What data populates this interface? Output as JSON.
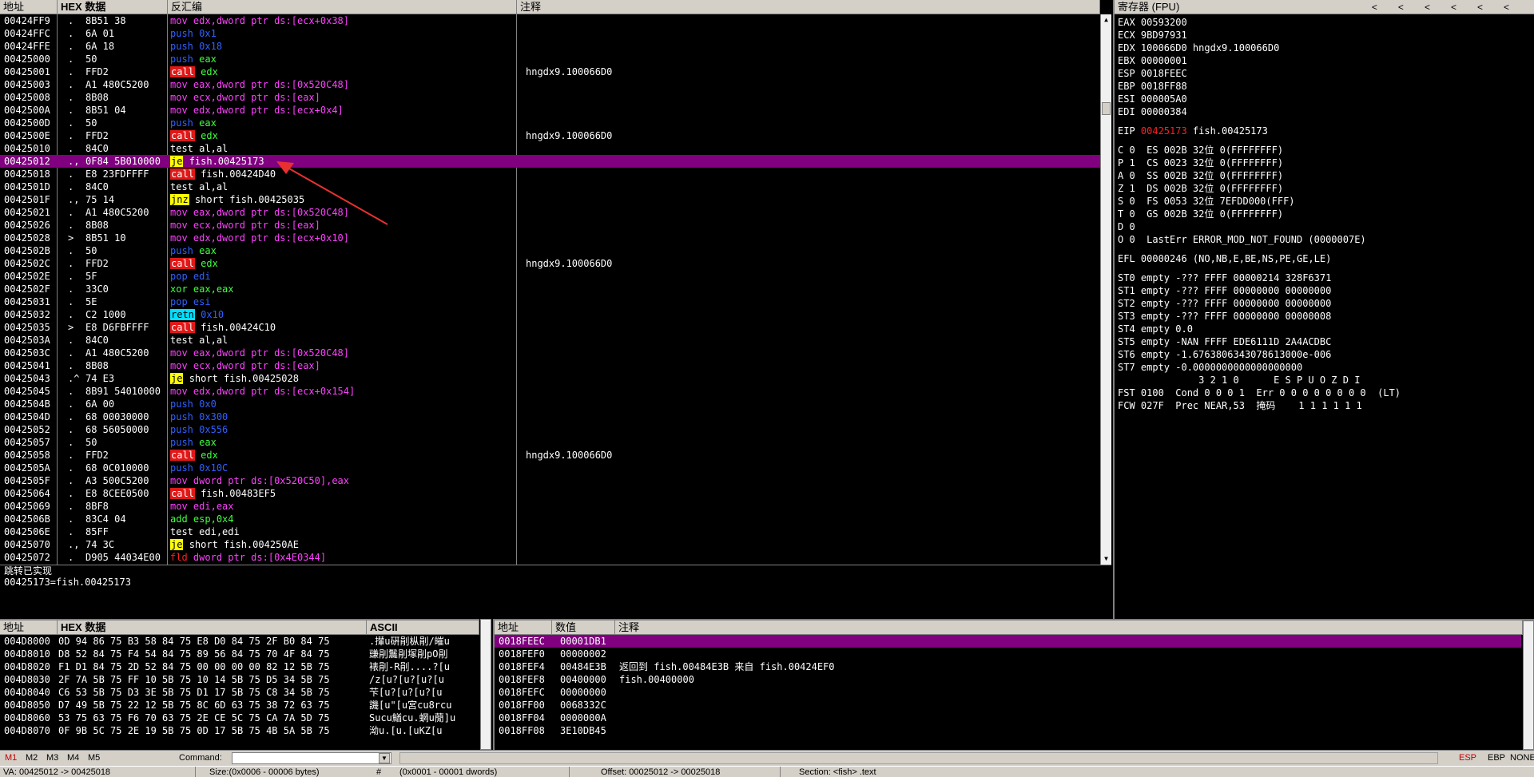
{
  "cpu": {
    "headers": {
      "addr": "地址",
      "hex": "HEX 数据",
      "disasm": "反汇编",
      "comment": "注释"
    },
    "rows": [
      {
        "addr": "00424FF9",
        "mark": ".",
        "hex": "8B51 38",
        "mn": "mov",
        "mnClass": "mn-mov",
        "ops": "edx,dword ptr ds:[ecx+0x38]",
        "opClass": "mn-mov",
        "cmt": ""
      },
      {
        "addr": "00424FFC",
        "mark": ".",
        "hex": "6A 01",
        "mn": "push",
        "mnClass": "mn-push",
        "ops": "0x1",
        "opClass": "mn-push",
        "cmt": ""
      },
      {
        "addr": "00424FFE",
        "mark": ".",
        "hex": "6A 18",
        "mn": "push",
        "mnClass": "mn-push",
        "ops": "0x18",
        "opClass": "mn-push",
        "cmt": ""
      },
      {
        "addr": "00425000",
        "mark": ".",
        "hex": "50",
        "mn": "push",
        "mnClass": "mn-push",
        "ops": "eax",
        "opClass": "op-green",
        "cmt": ""
      },
      {
        "addr": "00425001",
        "mark": ".",
        "hex": "FFD2",
        "mn": "call",
        "mnClass": "mn-call",
        "ops": "edx",
        "opClass": "op-green",
        "cmt": "hngdx9.100066D0"
      },
      {
        "addr": "00425003",
        "mark": ".",
        "hex": "A1 480C5200",
        "mn": "mov",
        "mnClass": "mn-mov",
        "ops": "eax,dword ptr ds:[0x520C48]",
        "opClass": "mn-mov",
        "cmt": ""
      },
      {
        "addr": "00425008",
        "mark": ".",
        "hex": "8B08",
        "mn": "mov",
        "mnClass": "mn-mov",
        "ops": "ecx,dword ptr ds:[eax]",
        "opClass": "mn-mov",
        "cmt": ""
      },
      {
        "addr": "0042500A",
        "mark": ".",
        "hex": "8B51 04",
        "mn": "mov",
        "mnClass": "mn-mov",
        "ops": "edx,dword ptr ds:[ecx+0x4]",
        "opClass": "mn-mov",
        "cmt": ""
      },
      {
        "addr": "0042500D",
        "mark": ".",
        "hex": "50",
        "mn": "push",
        "mnClass": "mn-push",
        "ops": "eax",
        "opClass": "op-green",
        "cmt": ""
      },
      {
        "addr": "0042500E",
        "mark": ".",
        "hex": "FFD2",
        "mn": "call",
        "mnClass": "mn-call",
        "ops": "edx",
        "opClass": "op-green",
        "cmt": "hngdx9.100066D0"
      },
      {
        "addr": "00425010",
        "mark": ".",
        "hex": "84C0",
        "mn": "test",
        "mnClass": "mn-test",
        "ops": "al,al",
        "opClass": "op-fish",
        "cmt": ""
      },
      {
        "addr": "00425012",
        "mark": ".,",
        "hex": "0F84 5B010000",
        "mn": "je",
        "mnClass": "mn-jmp",
        "ops": "fish.00425173",
        "opClass": "op-fish",
        "cmt": "",
        "sel": true
      },
      {
        "addr": "00425018",
        "mark": ".",
        "hex": "E8 23FDFFFF",
        "mn": "call",
        "mnClass": "mn-call",
        "ops": "fish.00424D40",
        "opClass": "op-fish",
        "cmt": ""
      },
      {
        "addr": "0042501D",
        "mark": ".",
        "hex": "84C0",
        "mn": "test",
        "mnClass": "mn-test",
        "ops": "al,al",
        "opClass": "op-fish",
        "cmt": ""
      },
      {
        "addr": "0042501F",
        "mark": ".,",
        "hex": "75 14",
        "mn": "jnz",
        "mnClass": "mn-jmp",
        "ops": "short fish.00425035",
        "opClass": "op-fish",
        "cmt": ""
      },
      {
        "addr": "00425021",
        "mark": ".",
        "hex": "A1 480C5200",
        "mn": "mov",
        "mnClass": "mn-mov",
        "ops": "eax,dword ptr ds:[0x520C48]",
        "opClass": "mn-mov",
        "cmt": ""
      },
      {
        "addr": "00425026",
        "mark": ".",
        "hex": "8B08",
        "mn": "mov",
        "mnClass": "mn-mov",
        "ops": "ecx,dword ptr ds:[eax]",
        "opClass": "mn-mov",
        "cmt": ""
      },
      {
        "addr": "00425028",
        "mark": ">",
        "hex": "8B51 10",
        "mn": "mov",
        "mnClass": "mn-mov",
        "ops": "edx,dword ptr ds:[ecx+0x10]",
        "opClass": "mn-mov",
        "cmt": ""
      },
      {
        "addr": "0042502B",
        "mark": ".",
        "hex": "50",
        "mn": "push",
        "mnClass": "mn-push",
        "ops": "eax",
        "opClass": "op-green",
        "cmt": ""
      },
      {
        "addr": "0042502C",
        "mark": ".",
        "hex": "FFD2",
        "mn": "call",
        "mnClass": "mn-call",
        "ops": "edx",
        "opClass": "op-green",
        "cmt": "hngdx9.100066D0"
      },
      {
        "addr": "0042502E",
        "mark": ".",
        "hex": "5F",
        "mn": "pop",
        "mnClass": "mn-pop",
        "ops": "edi",
        "opClass": "mn-pop",
        "cmt": ""
      },
      {
        "addr": "0042502F",
        "mark": ".",
        "hex": "33C0",
        "mn": "xor",
        "mnClass": "mn-xor",
        "ops": "eax,eax",
        "opClass": "op-green",
        "cmt": ""
      },
      {
        "addr": "00425031",
        "mark": ".",
        "hex": "5E",
        "mn": "pop",
        "mnClass": "mn-pop",
        "ops": "esi",
        "opClass": "mn-pop",
        "cmt": ""
      },
      {
        "addr": "00425032",
        "mark": ".",
        "hex": "C2 1000",
        "mn": "retn",
        "mnClass": "mn-ret",
        "ops": "0x10",
        "opClass": "mn-push",
        "cmt": ""
      },
      {
        "addr": "00425035",
        "mark": ">",
        "hex": "E8 D6FBFFFF",
        "mn": "call",
        "mnClass": "mn-call",
        "ops": "fish.00424C10",
        "opClass": "op-fish",
        "cmt": ""
      },
      {
        "addr": "0042503A",
        "mark": ".",
        "hex": "84C0",
        "mn": "test",
        "mnClass": "mn-test",
        "ops": "al,al",
        "opClass": "op-fish",
        "cmt": ""
      },
      {
        "addr": "0042503C",
        "mark": ".",
        "hex": "A1 480C5200",
        "mn": "mov",
        "mnClass": "mn-mov",
        "ops": "eax,dword ptr ds:[0x520C48]",
        "opClass": "mn-mov",
        "cmt": ""
      },
      {
        "addr": "00425041",
        "mark": ".",
        "hex": "8B08",
        "mn": "mov",
        "mnClass": "mn-mov",
        "ops": "ecx,dword ptr ds:[eax]",
        "opClass": "mn-mov",
        "cmt": ""
      },
      {
        "addr": "00425043",
        "mark": ".^",
        "hex": "74 E3",
        "mn": "je",
        "mnClass": "mn-jmp",
        "ops": "short fish.00425028",
        "opClass": "op-fish",
        "cmt": ""
      },
      {
        "addr": "00425045",
        "mark": ".",
        "hex": "8B91 54010000",
        "mn": "mov",
        "mnClass": "mn-mov",
        "ops": "edx,dword ptr ds:[ecx+0x154]",
        "opClass": "mn-mov",
        "cmt": ""
      },
      {
        "addr": "0042504B",
        "mark": ".",
        "hex": "6A 00",
        "mn": "push",
        "mnClass": "mn-push",
        "ops": "0x0",
        "opClass": "mn-push",
        "cmt": ""
      },
      {
        "addr": "0042504D",
        "mark": ".",
        "hex": "68 00030000",
        "mn": "push",
        "mnClass": "mn-push",
        "ops": "0x300",
        "opClass": "mn-push",
        "cmt": ""
      },
      {
        "addr": "00425052",
        "mark": ".",
        "hex": "68 56050000",
        "mn": "push",
        "mnClass": "mn-push",
        "ops": "0x556",
        "opClass": "mn-push",
        "cmt": ""
      },
      {
        "addr": "00425057",
        "mark": ".",
        "hex": "50",
        "mn": "push",
        "mnClass": "mn-push",
        "ops": "eax",
        "opClass": "op-green",
        "cmt": ""
      },
      {
        "addr": "00425058",
        "mark": ".",
        "hex": "FFD2",
        "mn": "call",
        "mnClass": "mn-call",
        "ops": "edx",
        "opClass": "op-green",
        "cmt": "hngdx9.100066D0"
      },
      {
        "addr": "0042505A",
        "mark": ".",
        "hex": "68 0C010000",
        "mn": "push",
        "mnClass": "mn-push",
        "ops": "0x10C",
        "opClass": "mn-push",
        "cmt": ""
      },
      {
        "addr": "0042505F",
        "mark": ".",
        "hex": "A3 500C5200",
        "mn": "mov",
        "mnClass": "mn-mov",
        "ops": "dword ptr ds:[0x520C50],eax",
        "opClass": "mn-mov",
        "cmt": ""
      },
      {
        "addr": "00425064",
        "mark": ".",
        "hex": "E8 8CEE0500",
        "mn": "call",
        "mnClass": "mn-call",
        "ops": "fish.00483EF5",
        "opClass": "op-fish",
        "cmt": ""
      },
      {
        "addr": "00425069",
        "mark": ".",
        "hex": "8BF8",
        "mn": "mov",
        "mnClass": "mn-mov",
        "ops": "edi,eax",
        "opClass": "mn-mov",
        "cmt": ""
      },
      {
        "addr": "0042506B",
        "mark": ".",
        "hex": "83C4 04",
        "mn": "add",
        "mnClass": "mn-add",
        "ops": "esp,0x4",
        "opClass": "op-green",
        "cmt": ""
      },
      {
        "addr": "0042506E",
        "mark": ".",
        "hex": "85FF",
        "mn": "test",
        "mnClass": "mn-test",
        "ops": "edi,edi",
        "opClass": "op-fish",
        "cmt": ""
      },
      {
        "addr": "00425070",
        "mark": ".,",
        "hex": "74 3C",
        "mn": "je",
        "mnClass": "mn-jmp",
        "ops": "short fish.004250AE",
        "opClass": "op-fish",
        "cmt": ""
      },
      {
        "addr": "00425072",
        "mark": ".",
        "hex": "D905 44034E00",
        "mn": "fld",
        "mnClass": "mn-fld",
        "ops": "dword ptr ds:[0x4E0344]",
        "opClass": "mn-mov",
        "cmt": ""
      }
    ]
  },
  "info": {
    "line1": "跳转已实现",
    "line2": "00425173=fish.00425173"
  },
  "registers": {
    "title": "寄存器 (FPU)",
    "arrows": [
      "<",
      "<",
      "<",
      "<",
      "<",
      "<"
    ],
    "lines": [
      {
        "t": "EAX 00593200"
      },
      {
        "t": "ECX 9BD97931"
      },
      {
        "t": "EDX 100066D0 hngdx9.100066D0"
      },
      {
        "t": "EBX 00000001"
      },
      {
        "t": "ESP 0018FEEC"
      },
      {
        "t": "EBP 0018FF88"
      },
      {
        "t": "ESI 000005A0"
      },
      {
        "t": "EDI 00000384"
      },
      {
        "t": "EIP ",
        "red": "00425173",
        "rest": " fish.00425173",
        "gap": true
      },
      {
        "t": "C 0  ES 002B 32位 0(FFFFFFFF)",
        "gap": true
      },
      {
        "t": "P 1  CS 0023 32位 0(FFFFFFFF)"
      },
      {
        "t": "A 0  SS 002B 32位 0(FFFFFFFF)"
      },
      {
        "t": "Z 1  DS 002B 32位 0(FFFFFFFF)"
      },
      {
        "t": "S 0  FS 0053 32位 7EFDD000(FFF)"
      },
      {
        "t": "T 0  GS 002B 32位 0(FFFFFFFF)"
      },
      {
        "t": "D 0"
      },
      {
        "t": "O 0  LastErr ERROR_MOD_NOT_FOUND (0000007E)"
      },
      {
        "t": "EFL 00000246 (NO,NB,E,BE,NS,PE,GE,LE)",
        "gap": true
      },
      {
        "t": "ST0 empty -??? FFFF 00000214 328F6371",
        "gap": true
      },
      {
        "t": "ST1 empty -??? FFFF 00000000 00000000"
      },
      {
        "t": "ST2 empty -??? FFFF 00000000 00000000"
      },
      {
        "t": "ST3 empty -??? FFFF 00000000 00000008"
      },
      {
        "t": "ST4 empty 0.0"
      },
      {
        "t": "ST5 empty -NAN FFFF EDE6111D 2A4ACDBC"
      },
      {
        "t": "ST6 empty -1.6763806343078613000e-006"
      },
      {
        "t": "ST7 empty -0.0000000000000000000"
      },
      {
        "t": "              3 2 1 0      E S P U O Z D I"
      },
      {
        "t": "FST 0100  Cond 0 0 0 1  Err 0 0 0 0 0 0 0 0  (LT)"
      },
      {
        "t": "FCW 027F  Prec NEAR,53  掩码    1 1 1 1 1 1"
      }
    ]
  },
  "dump": {
    "headers": {
      "addr": "地址",
      "hex": "HEX 数据",
      "ascii": "ASCII"
    },
    "rows": [
      {
        "addr": "004D8000",
        "hex": "0D 94 86 75 B3 58 84 75 E8 D0 84 75 2F B0 84 75",
        "asc": ".攆u硏剈枞剈/皠u"
      },
      {
        "addr": "004D8010",
        "hex": "D8 52 84 75 F4 54 84 75 89 56 84 75 70 4F 84 75",
        "asc": "豏剈鬞剈塚剈pO剈"
      },
      {
        "addr": "004D8020",
        "hex": "F1 D1 84 75 2D 52 84 75 00 00 00 00 82 12 5B 75",
        "asc": "裱剈-R剈....?[u"
      },
      {
        "addr": "004D8030",
        "hex": "2F 7A 5B 75 FF 10 5B 75 10 14 5B 75 D5 34 5B 75",
        "asc": "/z[u?[u?[u?[u"
      },
      {
        "addr": "004D8040",
        "hex": "C6 53 5B 75 D3 3E 5B 75 D1 17 5B 75 C8 34 5B 75",
        "asc": "芐[u?[u?[u?[u"
      },
      {
        "addr": "004D8050",
        "hex": "D7 49 5B 75 22 12 5B 75 8C 6D 63 75 38 72 63 75",
        "asc": "譏[u\"[u宮cu8rcu"
      },
      {
        "addr": "004D8060",
        "hex": "53 75 63 75 F6 70 63 75 2E CE 5C 75 CA 7A 5D 75",
        "asc": "Sucu鰌cu.蝄u蕑]u"
      },
      {
        "addr": "004D8070",
        "hex": "0F 9B 5C 75 2E 19 5B 75 0D 17 5B 75 4B 5A 5B 75",
        "asc": "泑u.[u.[uKZ[u"
      }
    ]
  },
  "stack": {
    "headers": {
      "addr": "地址",
      "val": "数值",
      "cmt": "注释"
    },
    "rows": [
      {
        "addr": "0018FEEC",
        "val": "00001DB1",
        "cmt": "",
        "sel": true
      },
      {
        "addr": "0018FEF0",
        "val": "00000002",
        "cmt": ""
      },
      {
        "addr": "0018FEF4",
        "val": "00484E3B",
        "cmt": "返回到 fish.00484E3B 来自 fish.00424EF0"
      },
      {
        "addr": "0018FEF8",
        "val": "00400000",
        "cmt": "fish.00400000"
      },
      {
        "addr": "0018FEFC",
        "val": "00000000",
        "cmt": ""
      },
      {
        "addr": "0018FF00",
        "val": "0068332C",
        "cmt": ""
      },
      {
        "addr": "0018FF04",
        "val": "0000000A",
        "cmt": ""
      },
      {
        "addr": "0018FF08",
        "val": "3E10DB45",
        "cmt": ""
      }
    ]
  },
  "cmdbar": {
    "tabs": [
      "M1",
      "M2",
      "M3",
      "M4",
      "M5"
    ],
    "command_label": "Command:",
    "right": [
      "ESP",
      "EBP",
      "NONE"
    ]
  },
  "status": {
    "va": "VA: 00425012 -> 00425018",
    "size": "Size:(0x0006 - 00006 bytes)",
    "hash": "#",
    "dwords": "(0x0001 - 00001 dwords)",
    "offset": "Offset: 00025012 -> 00025018",
    "section": "Section: <fish> .text"
  },
  "colors": {
    "selection": "#800080",
    "call": "#e01818",
    "jump": "#ffff00",
    "retn": "#00e0ff",
    "eip": "#ff2020"
  }
}
